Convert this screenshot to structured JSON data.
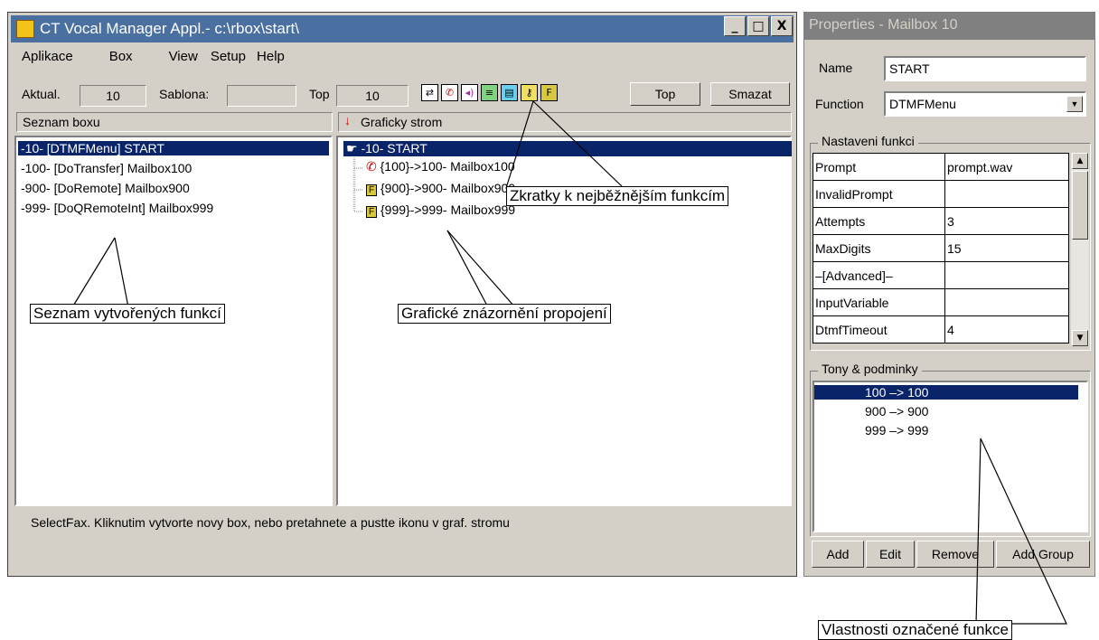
{
  "window": {
    "title": "CT Vocal Manager Appl.- c:\\rbox\\start\\",
    "buttons": {
      "minimize": "_",
      "maximize": "□",
      "close": "X"
    }
  },
  "menu": [
    "Aplikace",
    "Box",
    "View",
    "Setup",
    "Help"
  ],
  "toolbar": {
    "aktual_label": "Aktual.",
    "aktual_value": "10",
    "sablona_label": "Sablona:",
    "sablona_value": "",
    "top_label": "Top",
    "top_value": "10",
    "top_button": "Top",
    "smazat_button": "Smazat",
    "shortcut_icons": [
      "transfer-icon",
      "phone-icon",
      "speaker-icon",
      "menu-icon",
      "fax-icon",
      "key-icon",
      "function-icon"
    ]
  },
  "left_panel": {
    "header": "Seznam boxu",
    "items": [
      "-10- [DTMFMenu]  START",
      "-100- [DoTransfer]  Mailbox100",
      "-900- [DoRemote]  Mailbox900",
      "-999- [DoQRemoteInt]  Mailbox999"
    ],
    "selected_index": 0
  },
  "right_panel": {
    "header": "Graficky strom",
    "nodes": [
      "-10- START",
      "{100}->100- Mailbox100",
      "{900}->900- Mailbox900",
      "{999}->999- Mailbox999"
    ]
  },
  "status": "SelectFax. Kliknutim vytvorte novy box, nebo pretahnete a pustte ikonu v graf. stromu",
  "properties": {
    "title": "Properties - Mailbox 10",
    "name_label": "Name",
    "name_value": "START",
    "function_label": "Function",
    "function_value": "DTMFMenu",
    "group1_title": "Nastaveni funkci",
    "rows": [
      {
        "key": "Prompt",
        "value": "prompt.wav"
      },
      {
        "key": "InvalidPrompt",
        "value": ""
      },
      {
        "key": "Attempts",
        "value": "3"
      },
      {
        "key": "MaxDigits",
        "value": "15"
      },
      {
        "key": "–[Advanced]–",
        "value": ""
      },
      {
        "key": "InputVariable",
        "value": ""
      },
      {
        "key": "DtmfTimeout",
        "value": "4"
      }
    ],
    "group2_title": "Tony & podminky",
    "tones": [
      "100  –>  100",
      "900  –>  900",
      "999  –>  999"
    ],
    "buttons": [
      "Add",
      "Edit",
      "Remove",
      "Add Group"
    ]
  },
  "callouts": {
    "shortcuts": "Zkratky k nejběžnějším funkcím",
    "list": "Seznam vytvořených funkcí",
    "graph": "Grafické znázornění propojení",
    "props": "Vlastnosti označené funkce"
  },
  "colors": {
    "selection": "#0a246a",
    "titlebar": "#4a6fa1",
    "face": "#d4d0c8"
  }
}
